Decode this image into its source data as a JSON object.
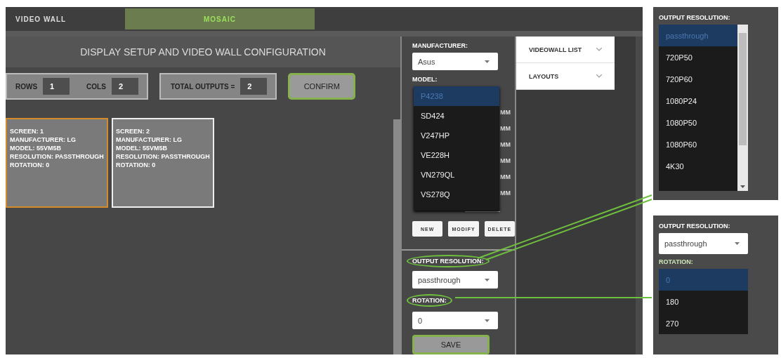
{
  "tabs": [
    {
      "label": "VIDEO WALL",
      "selected": false
    },
    {
      "label": "MOSAIC",
      "selected": true
    }
  ],
  "setup": {
    "title": "DISPLAY SETUP AND VIDEO WALL CONFIGURATION",
    "rows_label": "ROWS",
    "rows": "1",
    "cols_label": "COLS",
    "cols": "2",
    "total_label": "TOTAL OUTPUTS =",
    "total": "2",
    "confirm": "CONFIRM"
  },
  "screens": [
    {
      "selected": true,
      "lines": [
        "SCREEN: 1",
        "MANUFACTURER: LG",
        "MODEL: 55VM5B",
        "RESOLUTION: PASSTHROUGH",
        "ROTATION: 0"
      ]
    },
    {
      "selected": false,
      "lines": [
        "SCREEN: 2",
        "MANUFACTURER: LG",
        "MODEL: 55VM5B",
        "RESOLUTION: PASSTHROUGH",
        "ROTATION: 0"
      ]
    }
  ],
  "editor": {
    "manufacturer_label": "MANUFACTURER:",
    "manufacturer": "Asus",
    "model_label": "MODEL:",
    "model_options": [
      {
        "label": "P4238",
        "selected": true
      },
      {
        "label": "SD424",
        "selected": false
      },
      {
        "label": "V247HP",
        "selected": false
      },
      {
        "label": "VE228H",
        "selected": false
      },
      {
        "label": "VN279QL",
        "selected": false
      },
      {
        "label": "VS278Q",
        "selected": false
      }
    ],
    "hidden_fragments": [
      "MM",
      "MM",
      "MM",
      "MM",
      "MM",
      "MM"
    ],
    "buttons": [
      "NEW",
      "MODIFY",
      "DELETE"
    ],
    "resolution_label": "OUTPUT RESOLUTION:",
    "resolution": "passthrough",
    "rotation_label": "ROTATION:",
    "rotation": "0",
    "save": "SAVE"
  },
  "accordion": [
    {
      "label": "VIDEOWALL LIST",
      "expanded": false
    },
    {
      "label": "LAYOUTS",
      "expanded": false
    }
  ],
  "insets": [
    {
      "label": "OUTPUT RESOLUTION:",
      "options": [
        {
          "label": "passthrough",
          "selected": true
        },
        {
          "label": "720P50",
          "selected": false
        },
        {
          "label": "720P60",
          "selected": false
        },
        {
          "label": "1080P24",
          "selected": false
        },
        {
          "label": "1080P50",
          "selected": false
        },
        {
          "label": "1080P60",
          "selected": false
        },
        {
          "label": "4K30",
          "selected": false
        }
      ]
    },
    {
      "label": "OUTPUT RESOLUTION:",
      "value": "passthrough",
      "sublabel": "ROTATION:",
      "options": [
        {
          "label": "0",
          "selected": true
        },
        {
          "label": "180",
          "selected": false
        },
        {
          "label": "270",
          "selected": false
        }
      ]
    }
  ]
}
